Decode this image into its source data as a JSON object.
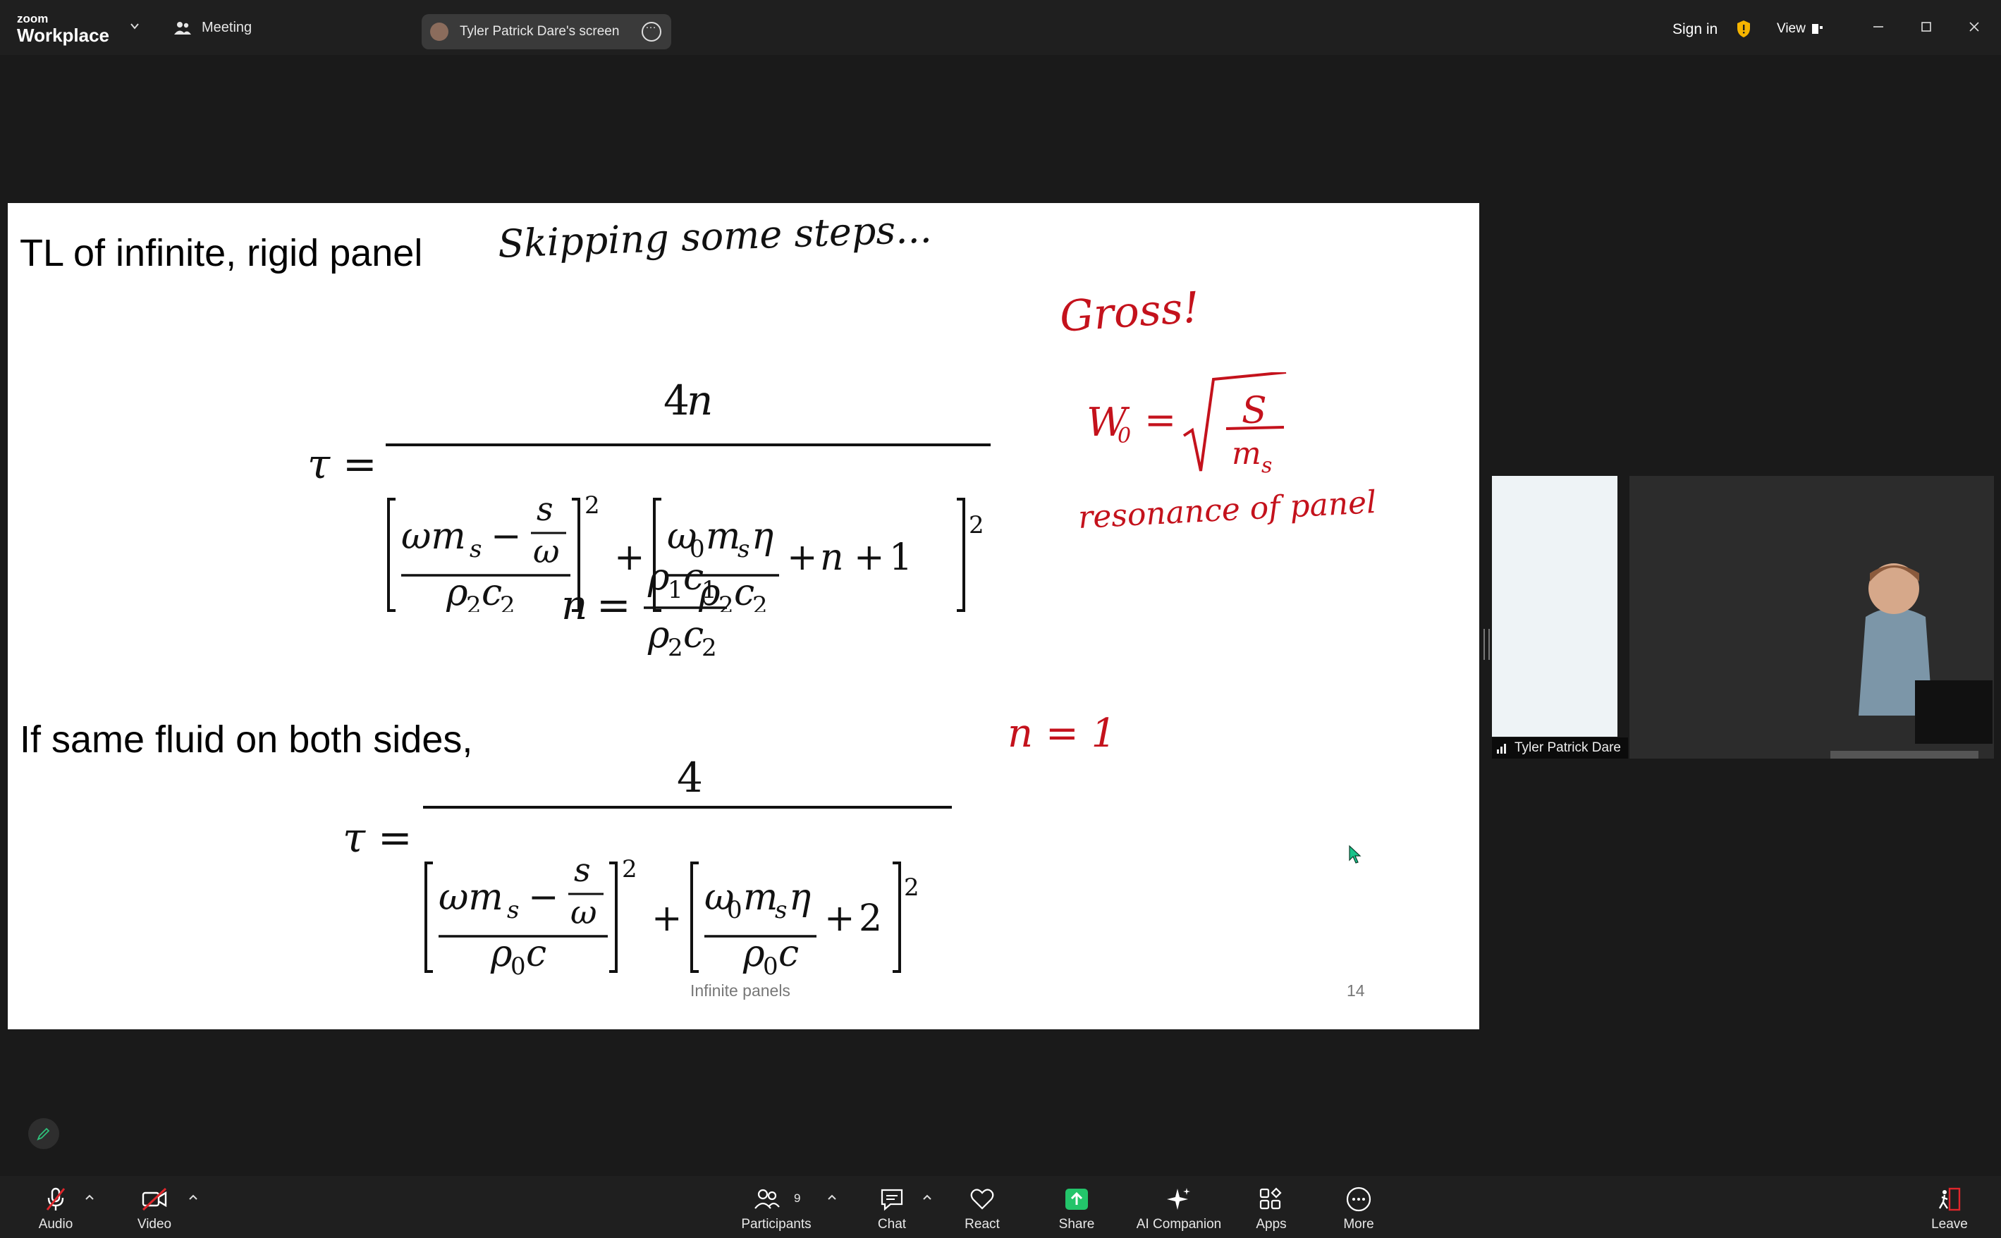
{
  "app": {
    "brand_small": "zoom",
    "brand_big": "Workplace",
    "meeting_label": "Meeting"
  },
  "share_pill": {
    "label": "Tyler Patrick Dare's screen"
  },
  "topright": {
    "sign_in": "Sign in",
    "view": "View"
  },
  "slide": {
    "title": "TL of infinite, rigid panel",
    "handwritten_note": "Skipping some steps...",
    "subheading": "If same fluid on both sides,",
    "footer_center": "Infinite panels",
    "footer_number": "14",
    "red_notes": {
      "gross": "Gross!",
      "omega": "W",
      "omega_sub": "0",
      "eq": "=",
      "S": "S",
      "ms": "m",
      "ms_sub": "s",
      "resonance": "resonance of panel",
      "n_eq": "n = 1"
    }
  },
  "video": {
    "participant_name": "Tyler Patrick Dare"
  },
  "toolbar": {
    "audio": "Audio",
    "video": "Video",
    "participants": "Participants",
    "participants_count": "9",
    "chat": "Chat",
    "react": "React",
    "share": "Share",
    "ai_companion": "AI Companion",
    "apps": "Apps",
    "more": "More",
    "leave": "Leave"
  },
  "colors": {
    "share_green": "#23c46a",
    "annotation_red": "#c4121c",
    "shield_yellow": "#f5b400"
  }
}
